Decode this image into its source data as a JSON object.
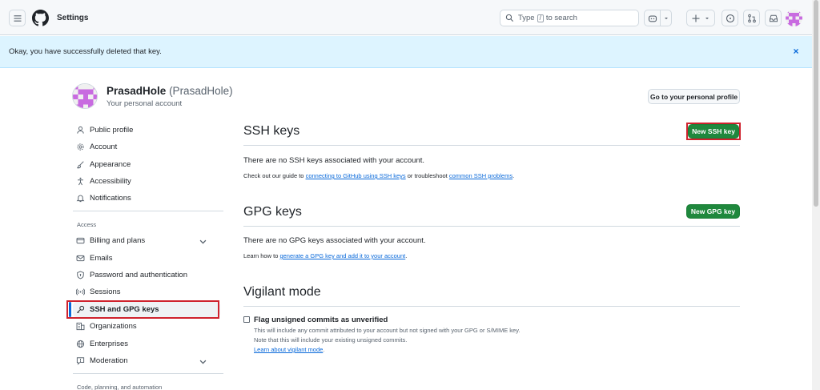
{
  "header": {
    "title": "Settings",
    "search_placeholder_pre": "Type",
    "search_key": "/",
    "search_placeholder_post": "to search"
  },
  "flash": {
    "message": "Okay, you have successfully deleted that key.",
    "close_icon": "×"
  },
  "profile": {
    "name": "PrasadHole",
    "handle": "(PrasadHole)",
    "subtitle": "Your personal account",
    "profile_button": "Go to your personal profile"
  },
  "sidebar": {
    "items": [
      {
        "label": "Public profile"
      },
      {
        "label": "Account"
      },
      {
        "label": "Appearance"
      },
      {
        "label": "Accessibility"
      },
      {
        "label": "Notifications"
      }
    ],
    "access_title": "Access",
    "access_items": [
      {
        "label": "Billing and plans"
      },
      {
        "label": "Emails"
      },
      {
        "label": "Password and authentication"
      },
      {
        "label": "Sessions"
      },
      {
        "label": "SSH and GPG keys"
      },
      {
        "label": "Organizations"
      },
      {
        "label": "Enterprises"
      },
      {
        "label": "Moderation"
      }
    ],
    "next_group": "Code, planning, and automation"
  },
  "ssh": {
    "title": "SSH keys",
    "button": "New SSH key",
    "empty": "There are no SSH keys associated with your account.",
    "guide_pre": "Check out our guide to",
    "guide_link1": "connecting to GitHub using SSH keys",
    "guide_mid": "or troubleshoot",
    "guide_link2": "common SSH problems",
    "guide_end": "."
  },
  "gpg": {
    "title": "GPG keys",
    "button": "New GPG key",
    "empty": "There are no GPG keys associated with your account.",
    "learn_pre": "Learn how to",
    "learn_link": "generate a GPG key and add it to your account",
    "learn_end": "."
  },
  "vigilant": {
    "title": "Vigilant mode",
    "checkbox_label": "Flag unsigned commits as unverified",
    "desc1": "This will include any commit attributed to your account but not signed with your GPG or S/MIME key.",
    "desc2": "Note that this will include your existing unsigned commits.",
    "link": "Learn about vigilant mode",
    "link_end": "."
  },
  "colors": {
    "accent": "#0969da",
    "primary_button": "#1f883d",
    "highlight": "#cf222e",
    "flash_bg": "#ddf4ff"
  }
}
